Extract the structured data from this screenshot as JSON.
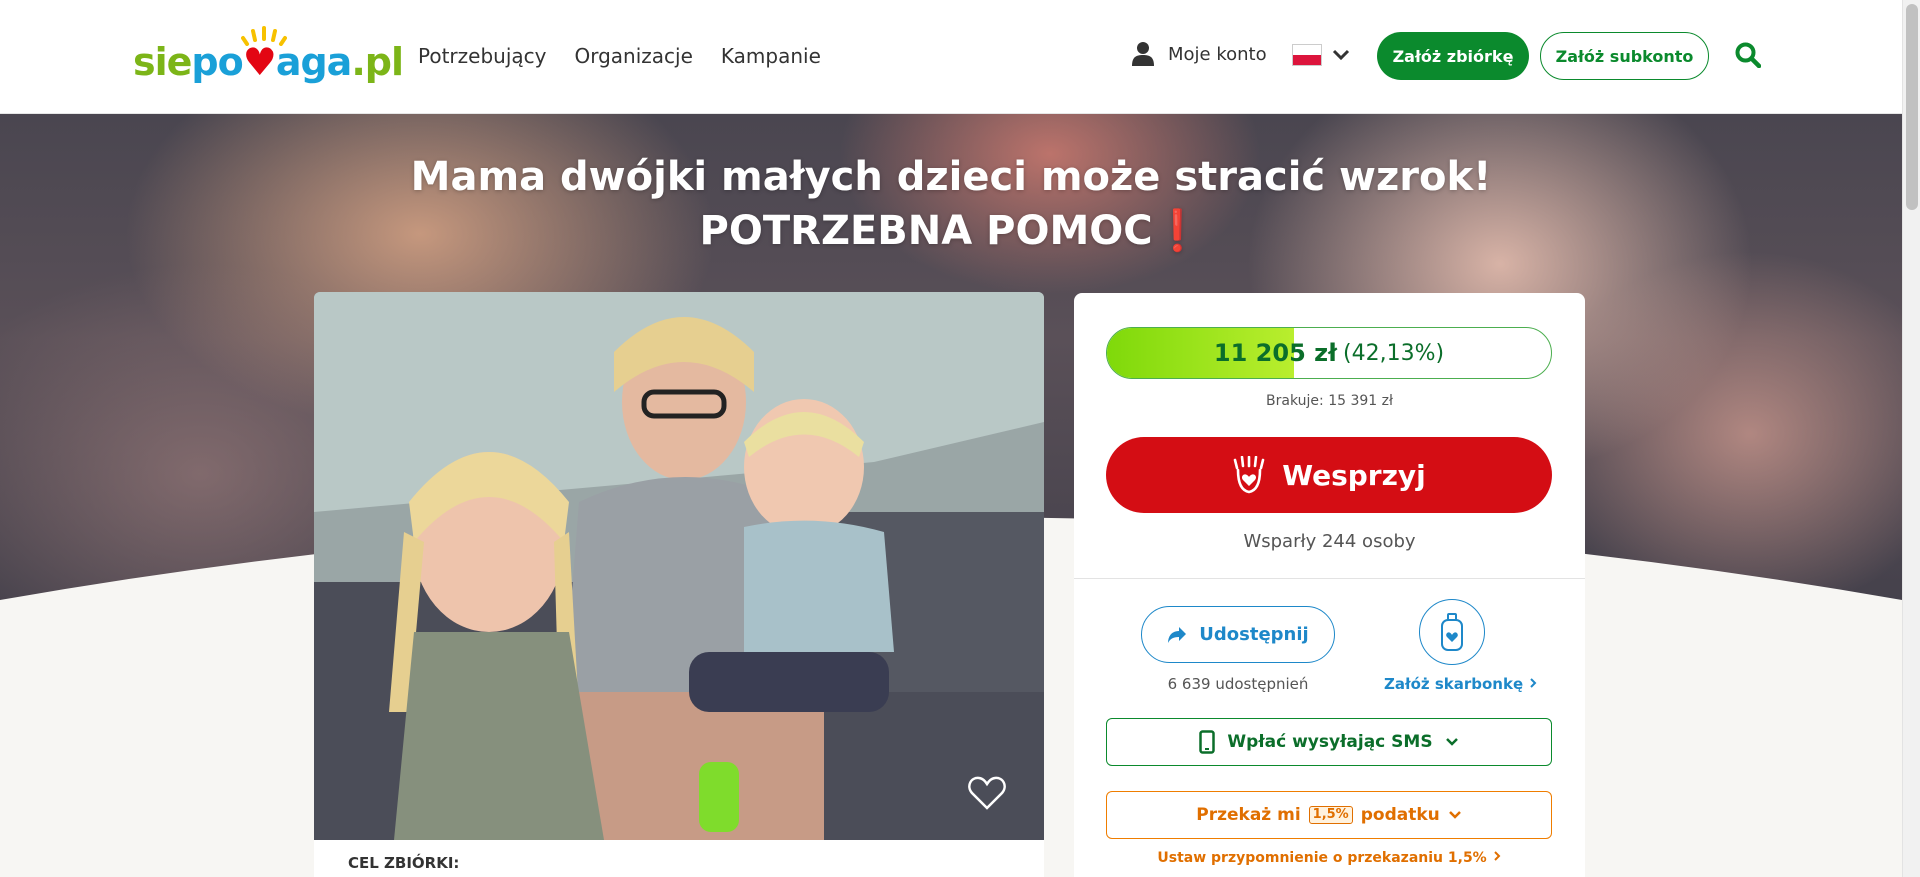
{
  "header": {
    "logo_text": "siepomaga.pl",
    "nav": [
      "Potrzebujący",
      "Organizacje",
      "Kampanie"
    ],
    "account_label": "Moje konto",
    "language": "PL",
    "create_fundraiser": "Załóż zbiórkę",
    "create_subaccount": "Załóż subkonto"
  },
  "hero": {
    "title_line1": "Mama dwójki małych dzieci może stracić wzrok!",
    "title_line2": "POTRZEBNA POMOC",
    "title_mark": "❗"
  },
  "goal": {
    "label": "CEL ZBIÓRKI:"
  },
  "donation": {
    "amount": "11 205 zł",
    "percent_text": "(42,13%)",
    "progress_fraction": 0.4213,
    "missing": "Brakuje: 15 391 zł",
    "support_button": "Wesprzyj",
    "supporters": "Wsparły 244 osoby",
    "share_button": "Udostępnij",
    "share_count": "6 639 udostępnień",
    "piggy_link": "Załóż skarbonkę",
    "sms_button": "Wpłać wysyłając SMS",
    "tax_prefix": "Przekaż mi",
    "tax_badge": "1,5%",
    "tax_suffix": "podatku",
    "reminder": "Ustaw przypomnienie o przekazaniu 1,5%"
  },
  "colors": {
    "brand_green": "#0b8a2d",
    "support_red": "#d40d14",
    "share_blue": "#1e88c9",
    "tax_orange": "#ef7d00",
    "progress_green": "#7fd90a"
  }
}
